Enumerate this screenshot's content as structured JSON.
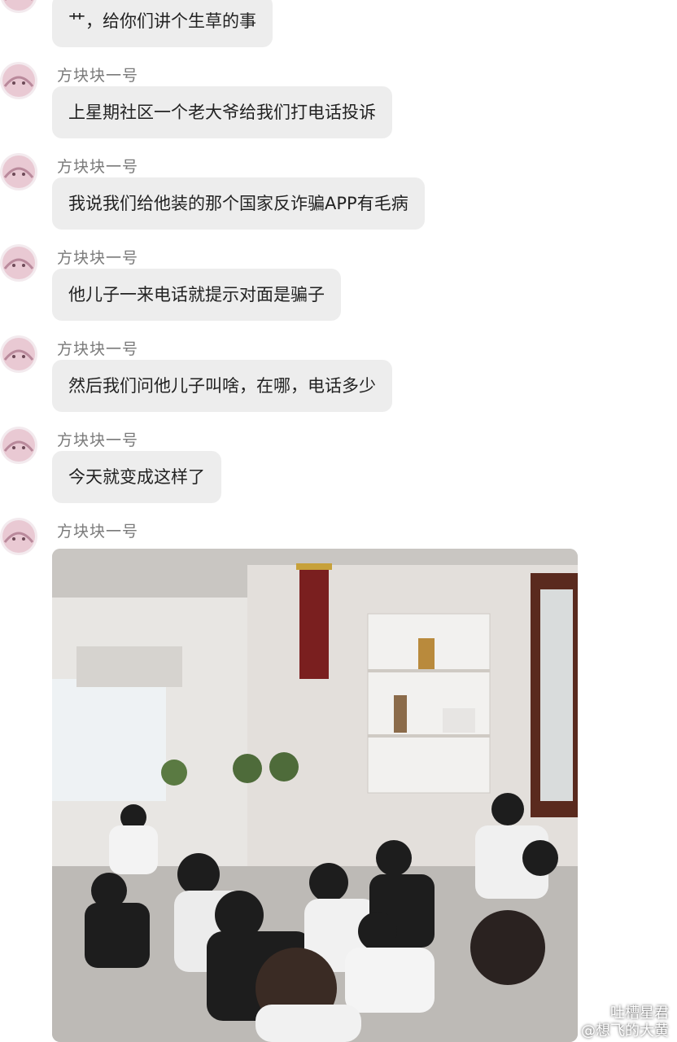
{
  "messages": [
    {
      "sender": "",
      "text": "艹，给你们讲个生草的事"
    },
    {
      "sender": "方块块一号",
      "text": "上星期社区一个老大爷给我们打电话投诉"
    },
    {
      "sender": "方块块一号",
      "text": "我说我们给他装的那个国家反诈骗APP有毛病"
    },
    {
      "sender": "方块块一号",
      "text": "他儿子一来电话就提示对面是骗子"
    },
    {
      "sender": "方块块一号",
      "text": "然后我们问他儿子叫啥，在哪，电话多少"
    },
    {
      "sender": "方块块一号",
      "text": "今天就变成这样了"
    },
    {
      "sender": "方块块一号",
      "text": ""
    }
  ],
  "watermark": {
    "line1": "吐槽星君",
    "line2": "@想飞的大黄"
  },
  "colors": {
    "bubble": "#ededed",
    "sender": "#7a7a7a",
    "avatar": "#f3eaee"
  }
}
